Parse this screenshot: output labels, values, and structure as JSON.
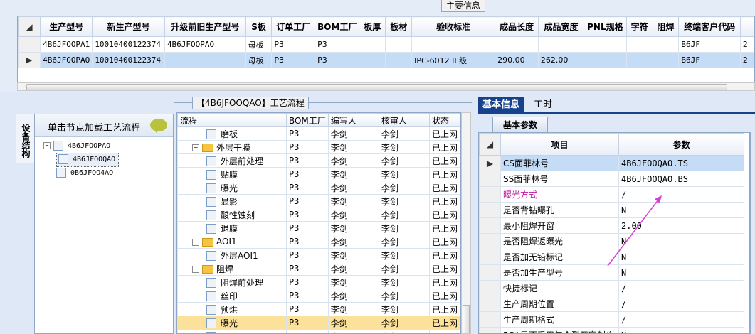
{
  "top": {
    "legend": "主要信息",
    "columns": [
      "生产型号",
      "新生产型号",
      "升级前旧生产型号",
      "S板",
      "订单工厂",
      "BOM工厂",
      "板厚",
      "板材",
      "验收标准",
      "成品长度",
      "成品宽度",
      "PNL规格",
      "字符",
      "阻焊",
      "终端客户代码",
      ""
    ],
    "rows": [
      {
        "cells": [
          "4B6JFOOPA1",
          "10010400122374",
          "4B6JFOOPAO",
          "母板",
          "P3",
          "P3",
          "",
          "",
          "",
          "",
          "",
          "",
          "",
          "",
          "B6JF",
          "2"
        ],
        "selected": false
      },
      {
        "cells": [
          "4B6JFOOPAO",
          "10010400122374",
          "",
          "母板",
          "P3",
          "P3",
          "",
          "",
          "IPC-6012 II 级",
          "290.00",
          "262.00",
          "",
          "",
          "",
          "B6JF",
          "2"
        ],
        "selected": true
      }
    ]
  },
  "left": {
    "vertical_tab": "设备结构",
    "hint": "单击节点加载工艺流程",
    "tree": [
      {
        "label": "4B6JFOOPAO",
        "level": 0
      },
      {
        "label": "4B6JFOOQAO",
        "level": 1
      },
      {
        "label": "0B6JFOO4AO",
        "level": 1
      }
    ]
  },
  "process": {
    "legend": "【4B6JFOOQAO】工艺流程",
    "columns": [
      "流程",
      "BOM工厂",
      "编写人",
      "核审人",
      "状态"
    ],
    "rows": [
      {
        "name": "磨板",
        "level": 2,
        "type": "doc",
        "bom": "P3",
        "writer": "李剑",
        "reviewer": "李剑",
        "status": "已上网"
      },
      {
        "name": "外层干膜",
        "level": 1,
        "type": "folder",
        "bom": "P3",
        "writer": "李剑",
        "reviewer": "李剑",
        "status": "已上网"
      },
      {
        "name": "外层前处理",
        "level": 2,
        "type": "doc",
        "bom": "P3",
        "writer": "李剑",
        "reviewer": "李剑",
        "status": "已上网"
      },
      {
        "name": "贴膜",
        "level": 2,
        "type": "doc",
        "bom": "P3",
        "writer": "李剑",
        "reviewer": "李剑",
        "status": "已上网"
      },
      {
        "name": "曝光",
        "level": 2,
        "type": "doc",
        "bom": "P3",
        "writer": "李剑",
        "reviewer": "李剑",
        "status": "已上网"
      },
      {
        "name": "显影",
        "level": 2,
        "type": "doc",
        "bom": "P3",
        "writer": "李剑",
        "reviewer": "李剑",
        "status": "已上网"
      },
      {
        "name": "酸性蚀刻",
        "level": 2,
        "type": "doc",
        "bom": "P3",
        "writer": "李剑",
        "reviewer": "李剑",
        "status": "已上网"
      },
      {
        "name": "退膜",
        "level": 2,
        "type": "doc",
        "bom": "P3",
        "writer": "李剑",
        "reviewer": "李剑",
        "status": "已上网"
      },
      {
        "name": "AOI1",
        "level": 1,
        "type": "folder",
        "bom": "P3",
        "writer": "李剑",
        "reviewer": "李剑",
        "status": "已上网"
      },
      {
        "name": "外层AOI1",
        "level": 2,
        "type": "doc",
        "bom": "P3",
        "writer": "李剑",
        "reviewer": "李剑",
        "status": "已上网"
      },
      {
        "name": "阻焊",
        "level": 1,
        "type": "folder",
        "bom": "P3",
        "writer": "李剑",
        "reviewer": "李剑",
        "status": "已上网"
      },
      {
        "name": "阻焊前处理",
        "level": 2,
        "type": "doc",
        "bom": "P3",
        "writer": "李剑",
        "reviewer": "李剑",
        "status": "已上网"
      },
      {
        "name": "丝印",
        "level": 2,
        "type": "doc",
        "bom": "P3",
        "writer": "李剑",
        "reviewer": "李剑",
        "status": "已上网"
      },
      {
        "name": "预烘",
        "level": 2,
        "type": "doc",
        "bom": "P3",
        "writer": "李剑",
        "reviewer": "李剑",
        "status": "已上网"
      },
      {
        "name": "曝光",
        "level": 2,
        "type": "doc",
        "bom": "P3",
        "writer": "李剑",
        "reviewer": "李剑",
        "status": "已上网",
        "selected": true
      },
      {
        "name": "显影",
        "level": 2,
        "type": "doc",
        "bom": "P3",
        "writer": "李剑",
        "reviewer": "李剑",
        "status": "已上网"
      }
    ]
  },
  "right": {
    "tabs": [
      "基本信息",
      "工时"
    ],
    "subtab": "基本参数",
    "columns": [
      "项目",
      "参数"
    ],
    "rows": [
      {
        "item": "CS面菲林号",
        "value": "4B6JFOOQAO.TS",
        "selected": true
      },
      {
        "item": "SS面菲林号",
        "value": "4B6JFOOQAO.BS"
      },
      {
        "item": "曝光方式",
        "value": "/",
        "highlight": true
      },
      {
        "item": "是否背钻曝孔",
        "value": "N"
      },
      {
        "item": "最小阻焊开窗",
        "value": "2.00"
      },
      {
        "item": "是否阻焊返曝光",
        "value": "N"
      },
      {
        "item": "是否加无铅标记",
        "value": "N"
      },
      {
        "item": "是否加生产型号",
        "value": "N"
      },
      {
        "item": "快捷标记",
        "value": "/"
      },
      {
        "item": "生产周期位置",
        "value": "/"
      },
      {
        "item": "生产周期格式",
        "value": "/"
      },
      {
        "item": "PCA是否采用复合型开窗制作",
        "value": "N"
      }
    ]
  },
  "colors": {
    "accent": "#15428b",
    "selection": "#c5dcf6",
    "tree_selection": "#fbe199",
    "annotation_arrow": "#d83cd8"
  }
}
